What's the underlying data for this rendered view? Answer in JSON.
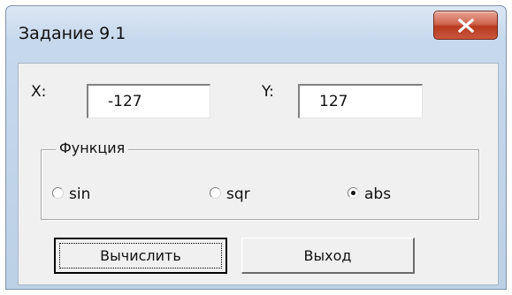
{
  "window": {
    "title": "Задание 9.1"
  },
  "fields": {
    "x_label": "X:",
    "x_value": "-127",
    "y_label": "Y:",
    "y_value": "127"
  },
  "function_group": {
    "caption": "Функция",
    "options": [
      {
        "label": "sin",
        "selected": false
      },
      {
        "label": "sqr",
        "selected": false
      },
      {
        "label": "abs",
        "selected": true
      }
    ]
  },
  "buttons": {
    "calculate_label": "Вычислить",
    "exit_label": "Выход"
  },
  "colors": {
    "close_button": "#c9573d",
    "window_frame": "#bcd0e6",
    "client_background": "#f0f0f0"
  }
}
